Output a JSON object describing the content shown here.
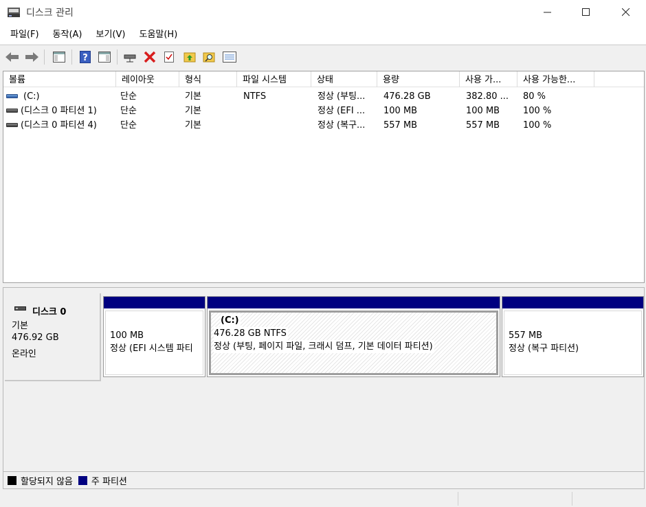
{
  "window": {
    "title": "디스크 관리",
    "minimize_icon": "minimize-icon",
    "maximize_icon": "maximize-icon",
    "close_icon": "close-icon"
  },
  "menu": [
    "파일(F)",
    "동작(A)",
    "보기(V)",
    "도움말(H)"
  ],
  "toolbar": {
    "icons": [
      "back-arrow-icon",
      "forward-arrow-icon",
      "show-hide-console-tree-icon",
      "help-icon",
      "show-hide-action-pane-icon",
      "connect-drive-icon",
      "delete-icon",
      "properties-icon",
      "up-folder-icon",
      "search-folder-icon",
      "list-view-icon"
    ],
    "delete_color": "#d81e1e"
  },
  "volume_list": {
    "columns": [
      "볼륨",
      "레이아웃",
      "형식",
      "파일 시스템",
      "상태",
      "용량",
      "사용 가...",
      "사용 가능한..."
    ],
    "rows": [
      {
        "volume": "(C:)",
        "layout": "단순",
        "type": "기본",
        "fs": "NTFS",
        "status": "정상 (부팅...",
        "capacity": "476.28 GB",
        "free": "382.80 ...",
        "pct": "80 %",
        "icon": "drive-blue"
      },
      {
        "volume": "(디스크 0 파티션 1)",
        "layout": "단순",
        "type": "기본",
        "fs": "",
        "status": "정상 (EFI ...",
        "capacity": "100 MB",
        "free": "100 MB",
        "pct": "100 %",
        "icon": "drive-gray"
      },
      {
        "volume": "(디스크 0 파티션 4)",
        "layout": "단순",
        "type": "기본",
        "fs": "",
        "status": "정상 (복구...",
        "capacity": "557 MB",
        "free": "557 MB",
        "pct": "100 %",
        "icon": "drive-gray"
      }
    ]
  },
  "disk": {
    "name": "디스크 0",
    "type": "기본",
    "size": "476.92 GB",
    "state": "온라인",
    "partitions": [
      {
        "title": "",
        "size": "100 MB",
        "status": "정상 (EFI 시스템 파티"
      },
      {
        "title": "(C:)",
        "size": "476.28 GB NTFS",
        "status": "정상 (부팅, 페이지 파일, 크래시 덤프, 기본 데이터 파티션)"
      },
      {
        "title": "",
        "size": "557 MB",
        "status": "정상 (복구 파티션)"
      }
    ]
  },
  "legend": [
    {
      "label": "할당되지 않음",
      "color": "#000000"
    },
    {
      "label": "주 파티션",
      "color": "#000080"
    }
  ]
}
